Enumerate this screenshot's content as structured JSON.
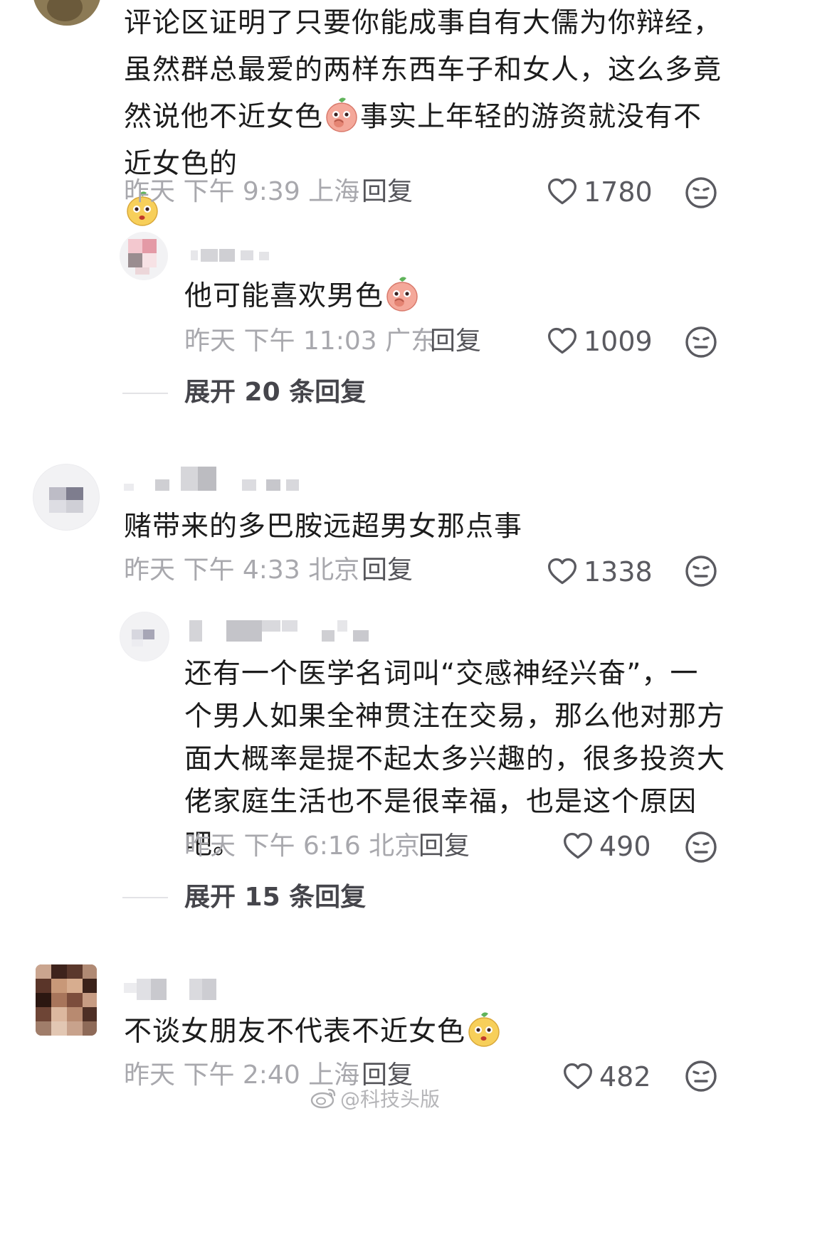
{
  "comments": [
    {
      "text": "评论区证明了只要你能成事自有大儒为你辩经，虽然群总最爱的两样东西车子和女人，这么多竟然说他不近女色",
      "text_after_emoji": "事实上年轻的游资就没有不近女色的",
      "meta": "昨天 下午 9:39 上海",
      "reply_label": "回复",
      "likes": "1780",
      "replies": [
        {
          "text": "他可能喜欢男色",
          "meta": "昨天 下午 11:03 广东",
          "reply_label": "回复",
          "likes": "1009"
        }
      ],
      "expand_label": "展开 20 条回复"
    },
    {
      "text": "赌带来的多巴胺远超男女那点事",
      "meta": "昨天 下午 4:33 北京",
      "reply_label": "回复",
      "likes": "1338",
      "replies": [
        {
          "text": "还有一个医学名词叫“交感神经兴奋”，一个男人如果全神贯注在交易，那么他对那方面大概率是提不起太多兴趣的，很多投资大佬家庭生活也不是很幸福，也是这个原因吧。",
          "meta": "昨天 下午 6:16 北京",
          "reply_label": "回复",
          "likes": "490"
        }
      ],
      "expand_label": "展开 15 条回复"
    },
    {
      "text": "不谈女朋友不代表不近女色",
      "meta": "昨天 下午 2:40 上海",
      "reply_label": "回复",
      "likes": "482"
    }
  ],
  "watermark": "@科技头版",
  "icons": {
    "like": "heart-outline-icon",
    "dislike": "meh-face-icon",
    "emoji_peach": "shy-peach-emoji",
    "emoji_yellow": "yellow-peach-emoji"
  },
  "colors": {
    "text": "#1c1c1c",
    "meta": "#a8a8ad",
    "reply_link": "#55555a",
    "like_count": "#5a5a60"
  }
}
